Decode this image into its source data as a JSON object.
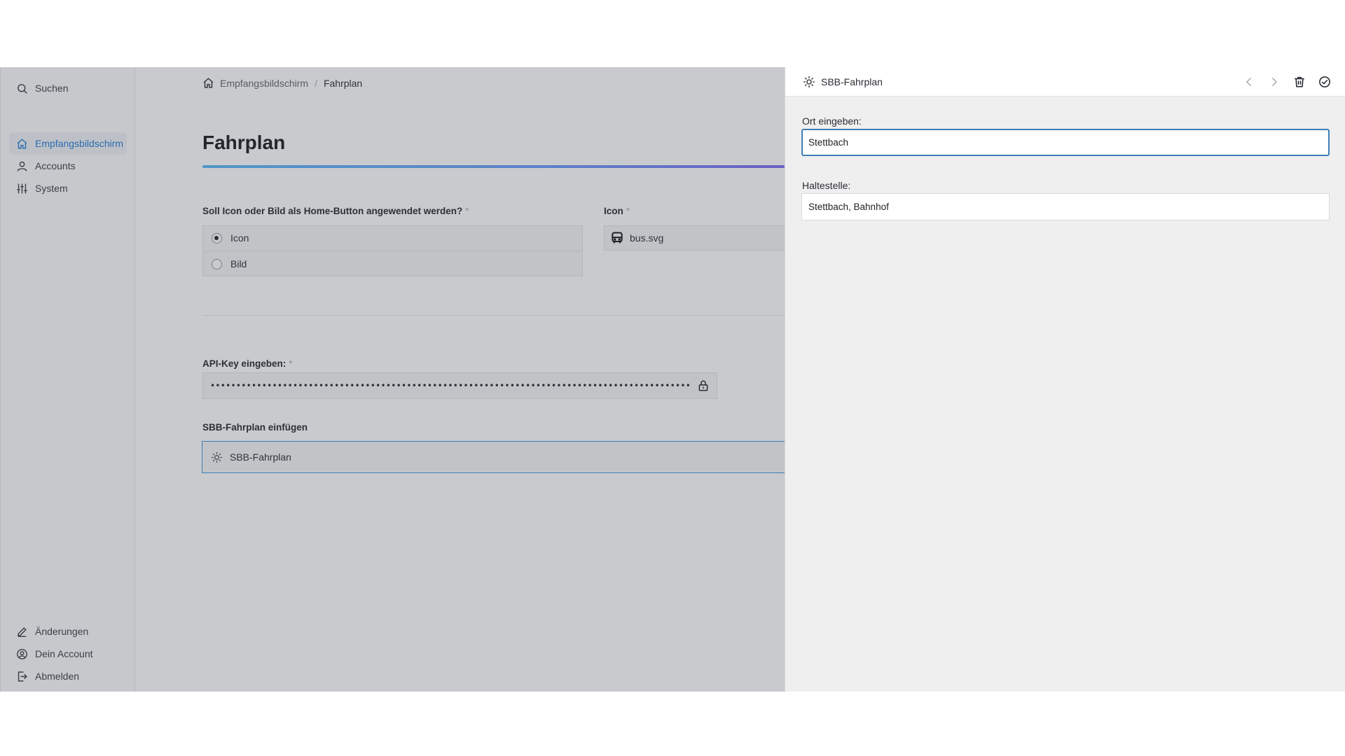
{
  "sidebar": {
    "search_label": "Suchen",
    "nav": [
      {
        "label": "Empfangsbildschirm",
        "icon": "home-icon",
        "active": true
      },
      {
        "label": "Accounts",
        "icon": "user-icon",
        "active": false
      },
      {
        "label": "System",
        "icon": "sliders-icon",
        "active": false
      }
    ],
    "footer": [
      {
        "label": "Änderungen",
        "icon": "pencil-icon"
      },
      {
        "label": "Dein Account",
        "icon": "user-circle-icon"
      },
      {
        "label": "Abmelden",
        "icon": "logout-icon"
      }
    ]
  },
  "main": {
    "breadcrumb": {
      "home": "Empfangsbildschirm",
      "separator": "/",
      "current": "Fahrplan"
    },
    "title": "Fahrplan",
    "home_button": {
      "label": "Soll Icon oder Bild als Home-Button angewendet werden?",
      "required_mark": "*",
      "options": [
        {
          "label": "Icon",
          "checked": true
        },
        {
          "label": "Bild",
          "checked": false
        }
      ]
    },
    "icon_field": {
      "label": "Icon",
      "required_mark": "*",
      "value": "bus.svg",
      "icon": "bus-icon"
    },
    "api_key": {
      "label": "API-Key eingeben:",
      "required_mark": "*",
      "masked_value": "••••••••••••••••••••••••••••••••••••••••••••••••••••••••••••••••••••••••••••••••••••••••••••••••••••••••••••••••••••••••••••",
      "icon": "lock-icon"
    },
    "sbb_insert": {
      "label": "SBB-Fahrplan einfügen",
      "item": "SBB-Fahrplan",
      "icon": "sun-icon"
    }
  },
  "panel": {
    "title": "SBB-Fahrplan",
    "title_icon": "sun-icon",
    "actions": [
      "chevron-left-icon",
      "chevron-right-icon",
      "trash-icon",
      "check-circle-icon"
    ],
    "location": {
      "label": "Ort eingeben:",
      "value": "Stettbach"
    },
    "stop": {
      "label": "Haltestelle:",
      "value": "Stettbach, Bahnhof"
    }
  },
  "colors": {
    "accent": "#2b6cb0",
    "focus": "#3f7fb6",
    "overlay": "#c9cace",
    "panel_bg": "#efefef"
  }
}
